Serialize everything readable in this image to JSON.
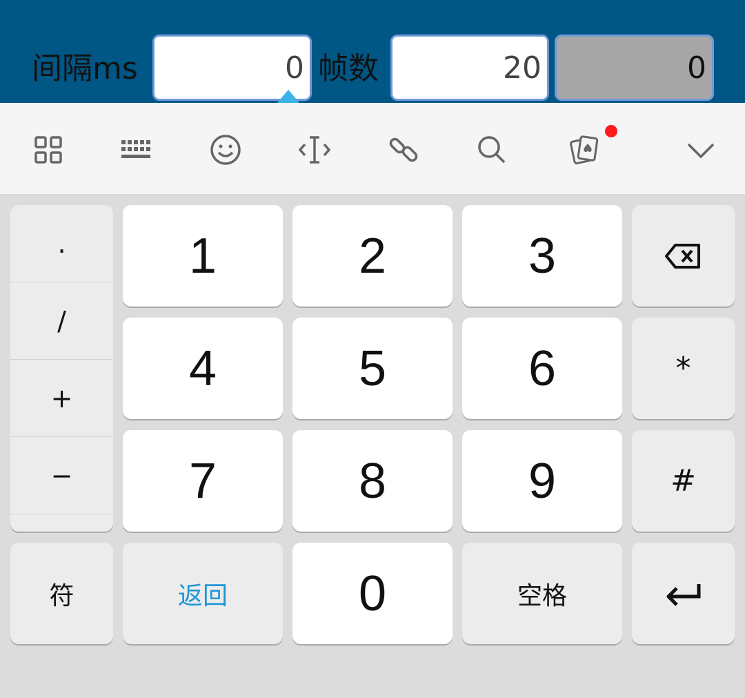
{
  "form": {
    "interval_label": "间隔ms",
    "interval_value": "0",
    "frames_label": "帧数",
    "frames_value": "20",
    "extra_value": "0"
  },
  "toolbar": {
    "icons": [
      "grid-icon",
      "keyboard-icon",
      "emoji-icon",
      "cursor-move-icon",
      "link-icon",
      "search-icon",
      "cards-icon",
      "chevron-down-icon"
    ],
    "notification_dot_color": "#ff1b1b"
  },
  "keyboard": {
    "side_symbols": [
      ".",
      "/",
      "+",
      "−"
    ],
    "digits": [
      "1",
      "2",
      "3",
      "4",
      "5",
      "6",
      "7",
      "8",
      "9",
      "0"
    ],
    "backspace_icon": "backspace-icon",
    "star": "*",
    "hash": "#",
    "symbols_label": "符",
    "back_label": "返回",
    "space_label": "空格",
    "enter_icon": "enter-icon"
  },
  "colors": {
    "appbar": "#005684",
    "field_border": "#6f9ad8",
    "accent_blue": "#1e96d8",
    "keyboard_bg": "#dcdcdc"
  }
}
